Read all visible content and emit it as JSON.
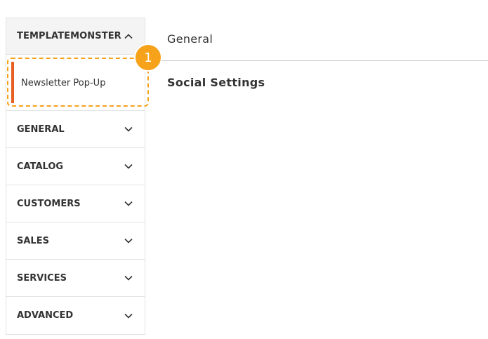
{
  "sidebar": {
    "group_title": "TEMPLATEMONSTER",
    "group_expanded": true,
    "subitem_label": "Newsletter Pop-Up",
    "sections": [
      {
        "label": "GENERAL"
      },
      {
        "label": "CATALOG"
      },
      {
        "label": "CUSTOMERS"
      },
      {
        "label": "SALES"
      },
      {
        "label": "SERVICES"
      },
      {
        "label": "ADVANCED"
      }
    ]
  },
  "callout": {
    "number": "1"
  },
  "main": {
    "title": "General",
    "subsection_title": "Social Settings"
  },
  "colors": {
    "accent": "#e75f22",
    "callout": "#f7a21b",
    "border": "#e3e3e3"
  },
  "icons": {
    "group_toggle": "chevron-up-icon",
    "section_toggle": "chevron-down-icon"
  }
}
